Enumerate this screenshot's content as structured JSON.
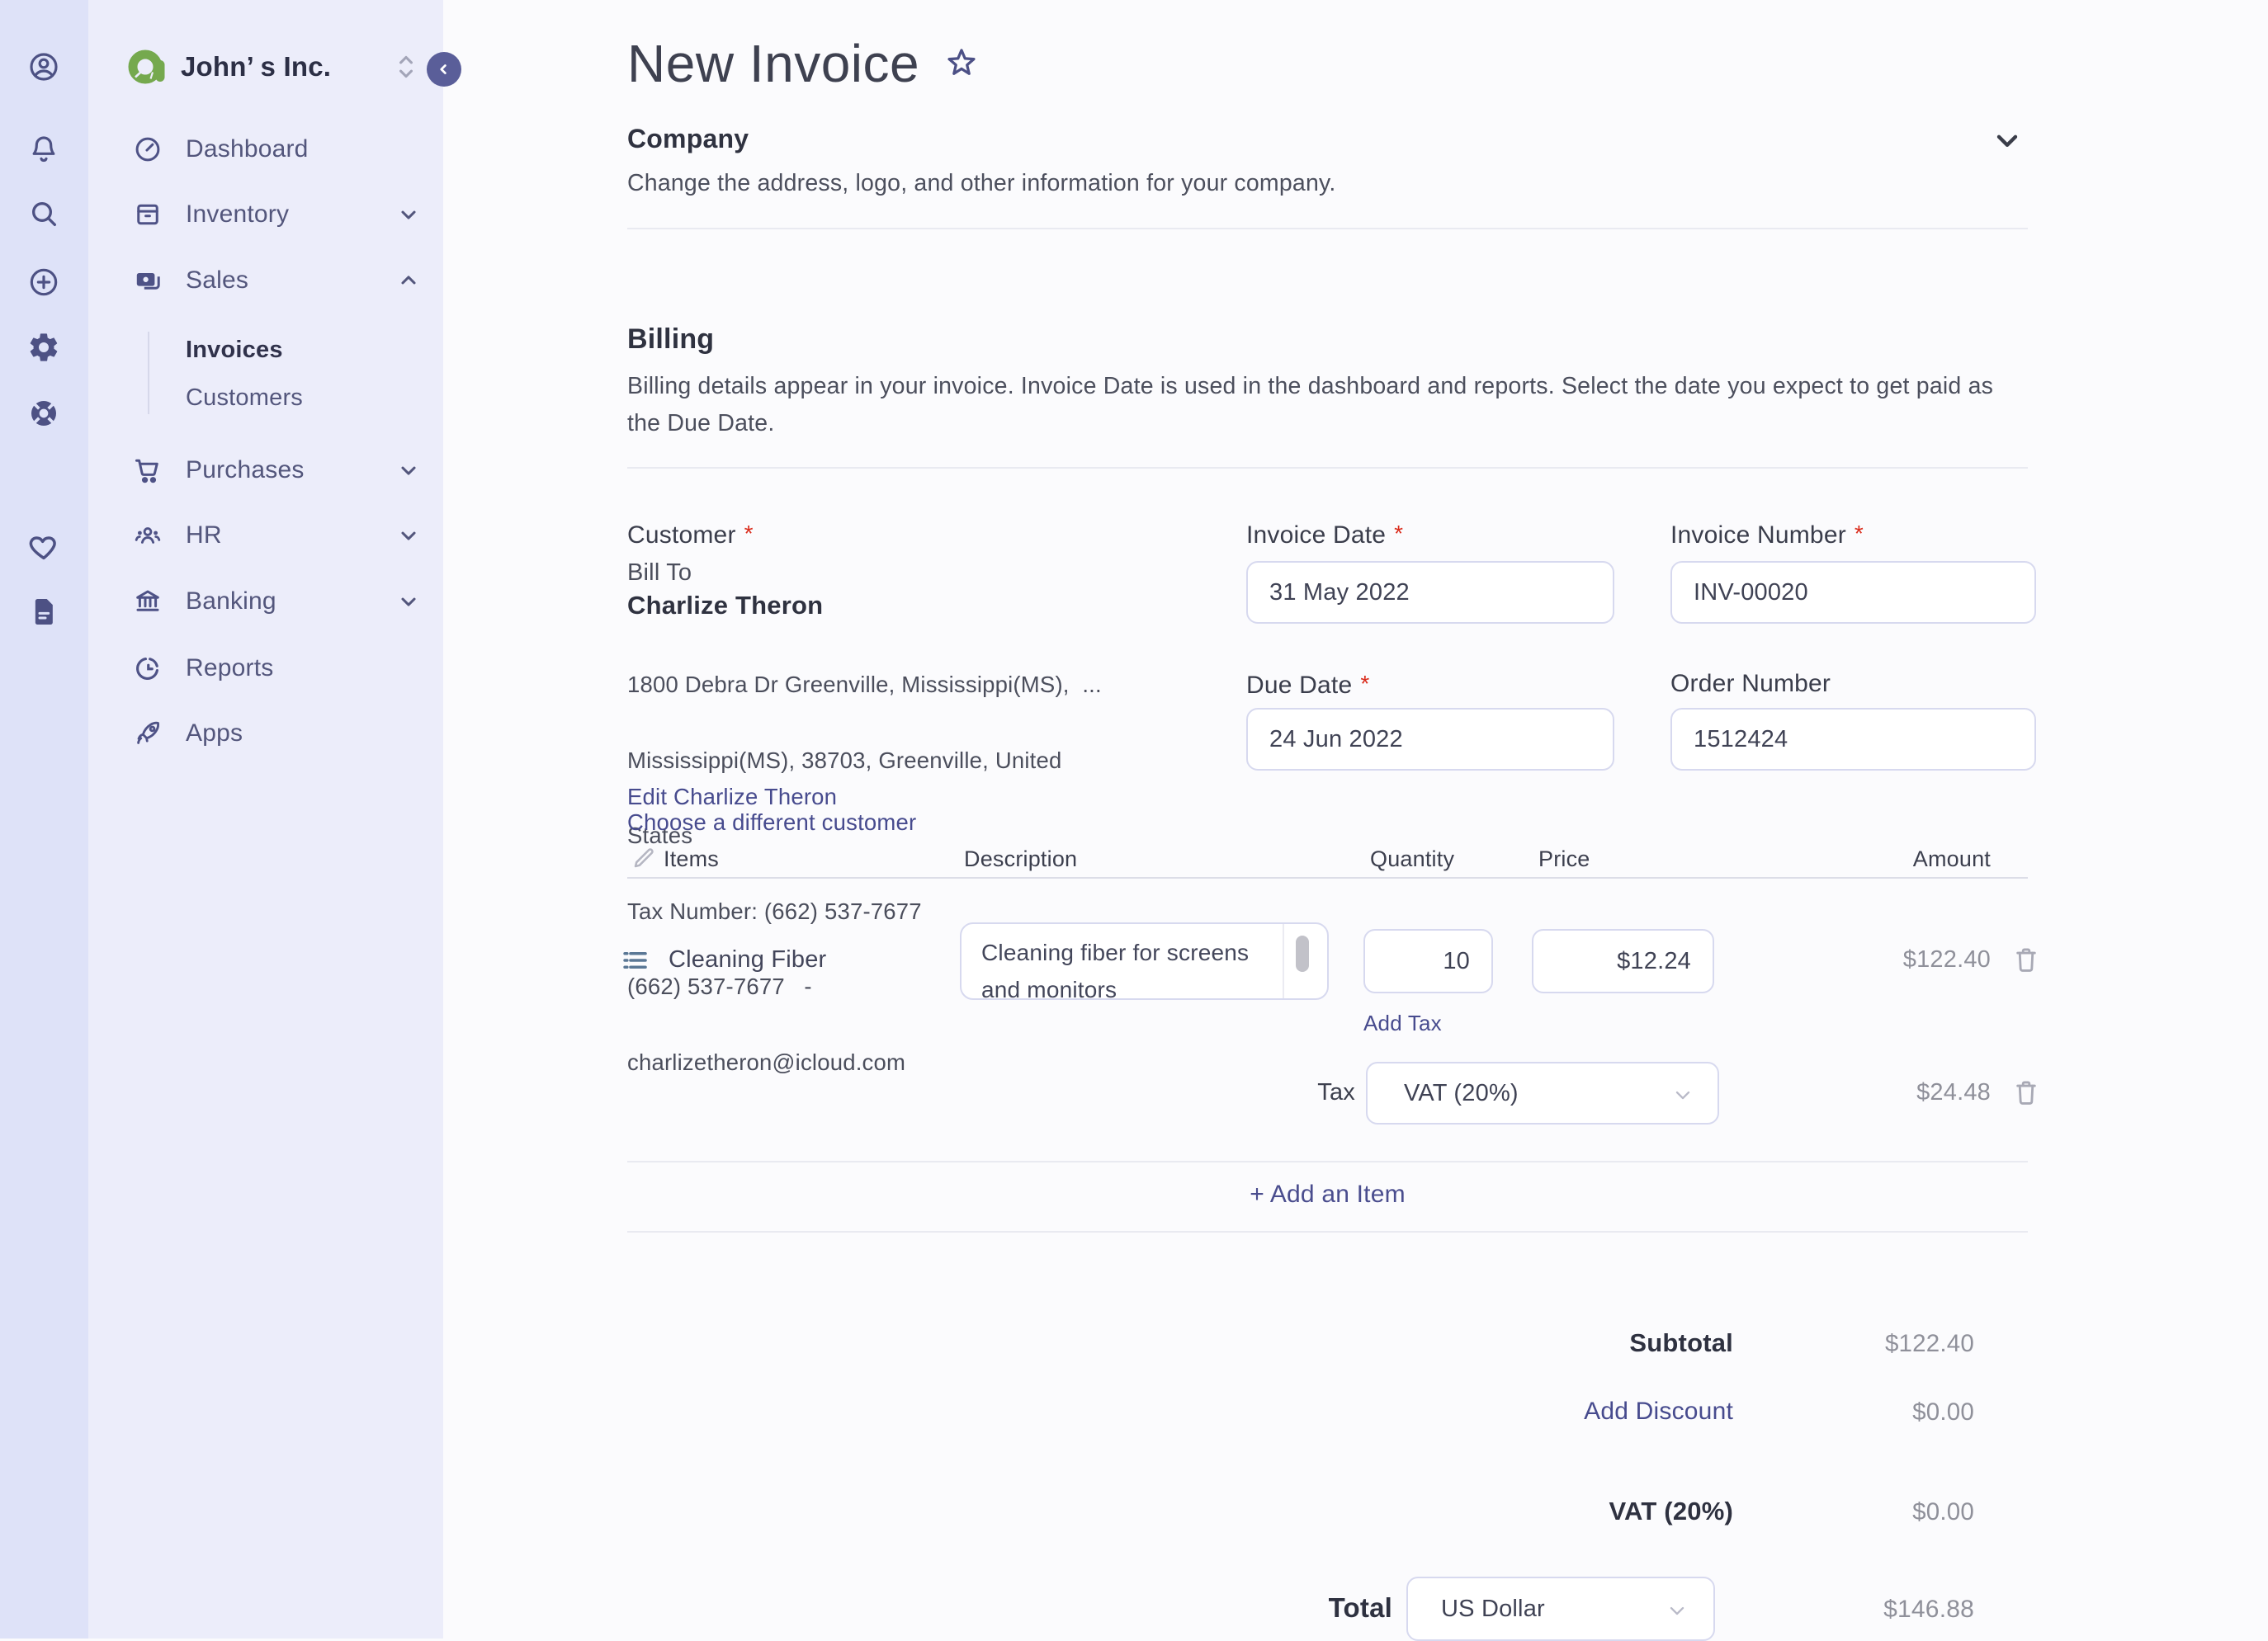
{
  "colors": {
    "accent_indigo": "#4e5286",
    "link_indigo": "#474b8e",
    "brand_green": "#75a94e",
    "required_red": "#da2c1c",
    "muted_value": "#8f909a",
    "rail_bg": "#dee2f8",
    "sidebar_bg": "#ecedfa",
    "main_bg": "#fbfbfd",
    "input_border": "#d7d9ef"
  },
  "required_marker": "*",
  "sidebar": {
    "company_name": "John’ s Inc.",
    "items": [
      {
        "label": "Dashboard"
      },
      {
        "label": "Inventory"
      },
      {
        "label": "Sales"
      },
      {
        "label": "Purchases"
      },
      {
        "label": "HR"
      },
      {
        "label": "Banking"
      },
      {
        "label": "Reports"
      },
      {
        "label": "Apps"
      }
    ],
    "subitems": [
      {
        "label": "Invoices"
      },
      {
        "label": "Customers"
      }
    ]
  },
  "page": {
    "title": "New Invoice"
  },
  "company_section": {
    "title": "Company",
    "description": "Change the address, logo, and other information for your company."
  },
  "billing_section": {
    "title": "Billing",
    "description": "Billing details appear in your invoice. Invoice Date is used in the dashboard and reports. Select the date you expect to get paid as the Due Date."
  },
  "customer": {
    "label": "Customer",
    "bill_to": "Bill To",
    "name": "Charlize Theron",
    "address_line1": "1800 Debra Dr Greenville, Mississippi(MS),  ...",
    "address_line2": "Mississippi(MS), 38703, Greenville, United",
    "address_line3": "States",
    "tax_number": "Tax Number: (662) 537-7677",
    "phone": "(662) 537-7677   -",
    "email": "charlizetheron@icloud.com",
    "edit_link": "Edit Charlize Theron",
    "choose_link": "Choose a different customer"
  },
  "fields": {
    "invoice_date": {
      "label": "Invoice Date",
      "value": "31 May 2022"
    },
    "invoice_number": {
      "label": "Invoice Number",
      "value": "INV-00020"
    },
    "due_date": {
      "label": "Due Date",
      "value": "24 Jun 2022"
    },
    "order_number": {
      "label": "Order Number",
      "value": "1512424"
    }
  },
  "items_table": {
    "headers": {
      "items": "Items",
      "description": "Description",
      "quantity": "Quantity",
      "price": "Price",
      "amount": "Amount"
    },
    "rows": [
      {
        "name": "Cleaning Fiber",
        "description": "Cleaning fiber for screens and monitors",
        "quantity": "10",
        "price": "$12.24",
        "amount": "$122.40"
      }
    ],
    "add_tax_label": "Add Tax",
    "tax_row": {
      "label": "Tax",
      "selected": "VAT (20%)",
      "amount": "$24.48"
    },
    "add_item_label": "+ Add an Item"
  },
  "totals": {
    "subtotal_label": "Subtotal",
    "subtotal_value": "$122.40",
    "discount_label": "Add Discount",
    "discount_value": "$0.00",
    "tax_label": "VAT (20%)",
    "tax_value": "$0.00",
    "total_label": "Total",
    "currency_value": "US Dollar",
    "total_value": "$146.88"
  }
}
